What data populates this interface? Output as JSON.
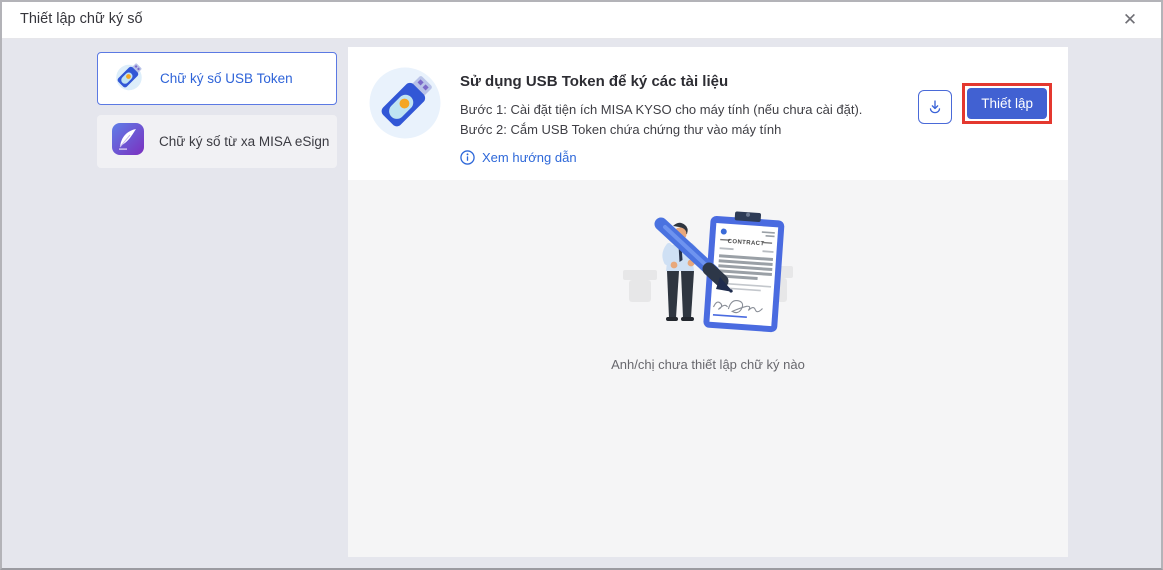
{
  "dialog": {
    "title": "Thiết lập chữ ký số",
    "close_glyph": "✕"
  },
  "colors": {
    "accent_blue": "#2e63d8",
    "button_blue": "#4161d2",
    "annotation_red": "#e4382f",
    "background_lavender": "#e5e6ed",
    "content_gray": "#f5f5f6",
    "esign_gradient": [
      "#5f7fe8",
      "#7b2fbf"
    ],
    "usb_orange": "#f5a623"
  },
  "sidebar": {
    "items": [
      {
        "label": "Chữ ký số USB Token",
        "icon": "usb-token-icon",
        "selected": true
      },
      {
        "label": "Chữ ký số từ xa MISA eSign",
        "icon": "esign-quill-icon",
        "selected": false
      }
    ]
  },
  "main": {
    "header": {
      "icon": "usb-token-large-icon",
      "title": "Sử dụng USB Token để ký các tài liệu",
      "steps": [
        "Bước 1: Cài đặt tiện ích MISA KYSO cho máy tính (nếu chưa cài đặt).",
        "Bước 2: Cắm USB Token chứa chứng thư vào máy tính"
      ],
      "guide_link": "Xem hướng dẫn",
      "download_icon": "download-icon",
      "setup_button": "Thiết lập"
    },
    "empty_state": {
      "illustration": "man-signing-contract-illustration",
      "contract_label": "CONTRACT",
      "message": "Anh/chị chưa thiết lập chữ ký nào"
    }
  }
}
